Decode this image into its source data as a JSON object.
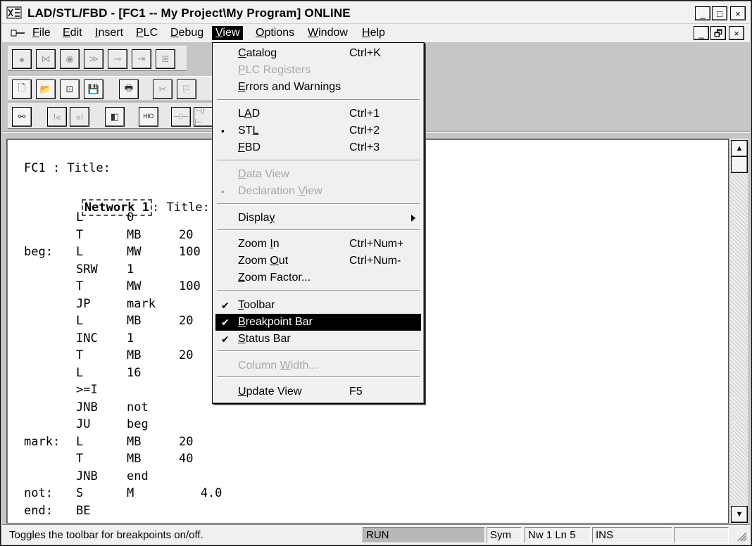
{
  "window": {
    "title": "LAD/STL/FBD  - [FC1 -- My Project\\My Program]  ONLINE",
    "controls": {
      "minimize": "_",
      "maximize": "□",
      "close": "×",
      "restore": "🗗"
    }
  },
  "menubar": {
    "items": [
      {
        "label": "File",
        "u": "F",
        "rest": "ile"
      },
      {
        "label": "Edit",
        "u": "E",
        "rest": "dit"
      },
      {
        "label": "Insert",
        "u": "I",
        "rest": "nsert"
      },
      {
        "label": "PLC",
        "u": "P",
        "rest": "LC"
      },
      {
        "label": "Debug",
        "u": "D",
        "rest": "ebug"
      },
      {
        "label": "View",
        "u": "V",
        "rest": "iew"
      },
      {
        "label": "Options",
        "u": "O",
        "rest": "ptions"
      },
      {
        "label": "Window",
        "u": "W",
        "rest": "indow"
      },
      {
        "label": "Help",
        "u": "H",
        "rest": "elp"
      }
    ]
  },
  "view_menu": {
    "items": [
      {
        "pre": "",
        "u": "C",
        "post": "atalog",
        "shortcut": "Ctrl+K",
        "state": "enabled",
        "mark": ""
      },
      {
        "pre": "",
        "u": "P",
        "post": "LC Registers",
        "shortcut": "",
        "state": "disabled",
        "mark": ""
      },
      {
        "pre": "",
        "u": "E",
        "post": "rrors and Warnings",
        "shortcut": "",
        "state": "enabled",
        "mark": ""
      },
      {
        "pre": "L",
        "u": "A",
        "post": "D",
        "shortcut": "Ctrl+1",
        "state": "enabled",
        "mark": ""
      },
      {
        "pre": "ST",
        "u": "L",
        "post": "",
        "shortcut": "Ctrl+2",
        "state": "enabled",
        "mark": "•"
      },
      {
        "pre": "",
        "u": "F",
        "post": "BD",
        "shortcut": "Ctrl+3",
        "state": "enabled",
        "mark": ""
      },
      {
        "pre": "",
        "u": "D",
        "post": "ata View",
        "shortcut": "",
        "state": "disabled",
        "mark": ""
      },
      {
        "pre": "Declaration ",
        "u": "V",
        "post": "iew",
        "shortcut": "",
        "state": "disabled",
        "mark": "•"
      },
      {
        "pre": "Displa",
        "u": "y",
        "post": "",
        "shortcut": "",
        "state": "enabled",
        "mark": ""
      },
      {
        "pre": "Zoom ",
        "u": "I",
        "post": "n",
        "shortcut": "Ctrl+Num+",
        "state": "enabled",
        "mark": ""
      },
      {
        "pre": "Zoom ",
        "u": "O",
        "post": "ut",
        "shortcut": "Ctrl+Num-",
        "state": "enabled",
        "mark": ""
      },
      {
        "pre": "",
        "u": "Z",
        "post": "oom Factor...",
        "shortcut": "",
        "state": "enabled",
        "mark": ""
      },
      {
        "pre": "",
        "u": "T",
        "post": "oolbar",
        "shortcut": "",
        "state": "enabled",
        "mark": "✔"
      },
      {
        "pre": "",
        "u": "B",
        "post": "reakpoint Bar",
        "shortcut": "",
        "state": "highlight",
        "mark": "✔"
      },
      {
        "pre": "",
        "u": "S",
        "post": "tatus Bar",
        "shortcut": "",
        "state": "enabled",
        "mark": "✔"
      },
      {
        "pre": "Column ",
        "u": "W",
        "post": "idth...",
        "shortcut": "",
        "state": "disabled",
        "mark": ""
      },
      {
        "pre": "",
        "u": "U",
        "post": "pdate View",
        "shortcut": "F5",
        "state": "enabled",
        "mark": ""
      }
    ]
  },
  "editor": {
    "block_title": "FC1 : Title:",
    "network_label": "Network 1",
    "network_title": ": Title:",
    "lines": [
      {
        "label": "",
        "op": "L",
        "arg": "0",
        "val": ""
      },
      {
        "label": "",
        "op": "T",
        "arg": "MB",
        "val": "20"
      },
      {
        "label": "beg:",
        "op": "L",
        "arg": "MW",
        "val": "100"
      },
      {
        "label": "",
        "op": "SRW",
        "arg": "1",
        "val": ""
      },
      {
        "label": "",
        "op": "T",
        "arg": "MW",
        "val": "100"
      },
      {
        "label": "",
        "op": "JP",
        "arg": "mark",
        "val": ""
      },
      {
        "label": "",
        "op": "L",
        "arg": "MB",
        "val": "20"
      },
      {
        "label": "",
        "op": "INC",
        "arg": "1",
        "val": ""
      },
      {
        "label": "",
        "op": "T",
        "arg": "MB",
        "val": "20"
      },
      {
        "label": "",
        "op": "L",
        "arg": "16",
        "val": ""
      },
      {
        "label": "",
        "op": ">=I",
        "arg": "",
        "val": ""
      },
      {
        "label": "",
        "op": "JNB",
        "arg": "not",
        "val": ""
      },
      {
        "label": "",
        "op": "JU",
        "arg": "beg",
        "val": ""
      },
      {
        "label": "mark:",
        "op": "L",
        "arg": "MB",
        "val": "20"
      },
      {
        "label": "",
        "op": "T",
        "arg": "MB",
        "val": "40"
      },
      {
        "label": "",
        "op": "JNB",
        "arg": "end",
        "val": ""
      },
      {
        "label": "not:",
        "op": "S",
        "arg": "M",
        "val": "   4.0"
      },
      {
        "label": "end:",
        "op": "BE",
        "arg": "",
        "val": ""
      }
    ]
  },
  "statusbar": {
    "hint": "Toggles the toolbar for breakpoints on/off.",
    "mode": "RUN",
    "sym": "Sym",
    "position": "Nw 1  Ln 5",
    "ins": "INS"
  },
  "toolbar": {
    "row1": [
      "●",
      "⋈",
      "◉",
      "≫",
      "⊸",
      "⇥",
      "⊞"
    ],
    "row2": [
      "🗋",
      "📂",
      "⊡",
      "💾",
      "🖶",
      "✂",
      "⎘"
    ],
    "row3": [
      "⚯",
      "!«",
      "»!",
      "◧",
      "ᴴᴵᴼ",
      "⊣⊢",
      "⊣/⊢"
    ]
  }
}
